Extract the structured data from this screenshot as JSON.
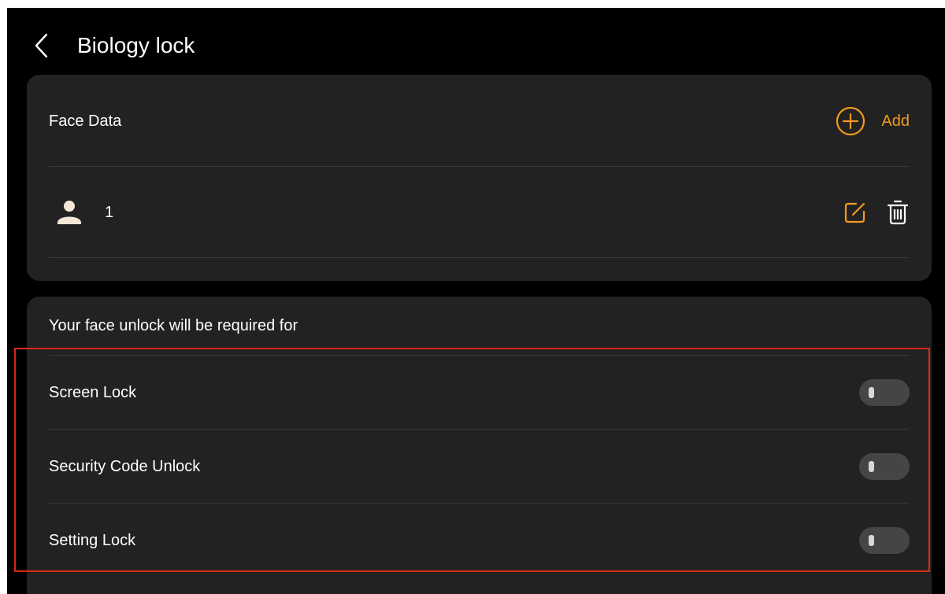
{
  "header": {
    "title": "Biology lock",
    "back_icon": "chevron-left-icon"
  },
  "face_data": {
    "label": "Face Data",
    "add_label": "Add",
    "add_icon": "plus-circle-icon",
    "entries": [
      {
        "name": "1",
        "avatar_icon": "user-icon",
        "edit_icon": "edit-icon",
        "delete_icon": "trash-icon"
      }
    ]
  },
  "requirements": {
    "heading": "Your face unlock will be required for",
    "items": [
      {
        "label": "Screen Lock",
        "enabled": false
      },
      {
        "label": "Security Code Unlock",
        "enabled": false
      },
      {
        "label": "Setting Lock",
        "enabled": false
      }
    ]
  },
  "colors": {
    "accent": "#f29a1e",
    "background": "#000000",
    "card": "#222222",
    "highlight_border": "#d9291b",
    "toggle_off": "#454545"
  }
}
